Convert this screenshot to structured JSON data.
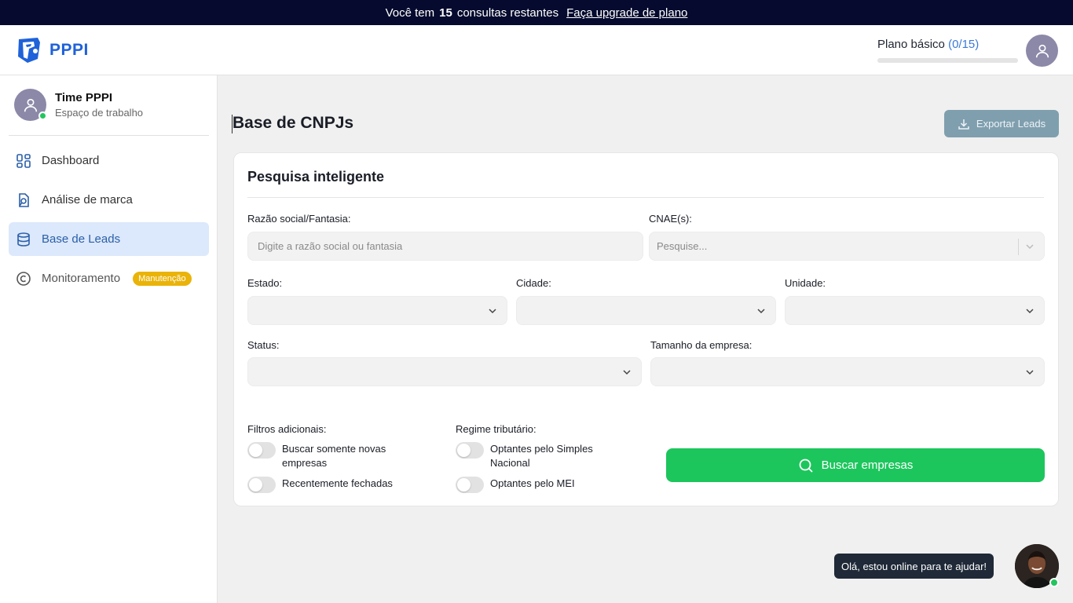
{
  "banner": {
    "prefix": "Você tem",
    "count": "15",
    "suffix": "consultas restantes",
    "link": "Faça upgrade de plano"
  },
  "header": {
    "brand": "PPPI",
    "plan_label": "Plano básico",
    "plan_count": "(0/15)",
    "plan_usage_fraction": 0
  },
  "sidebar": {
    "workspace_name": "Time PPPI",
    "workspace_sub": "Espaço de trabalho",
    "items": [
      {
        "label": "Dashboard",
        "icon": "dashboard-icon"
      },
      {
        "label": "Análise de marca",
        "icon": "brand-analysis-icon"
      },
      {
        "label": "Base de Leads",
        "icon": "database-icon",
        "active": true
      },
      {
        "label": "Monitoramento",
        "icon": "copyright-icon",
        "badge": "Manutenção"
      }
    ]
  },
  "main": {
    "title": "Base de CNPJs",
    "export_label": "Exportar Leads"
  },
  "search": {
    "title": "Pesquisa inteligente",
    "razao_label": "Razão social/Fantasia:",
    "razao_placeholder": "Digite a razão social ou fantasia",
    "cnae_label": "CNAE(s):",
    "cnae_placeholder": "Pesquise...",
    "estado_label": "Estado:",
    "cidade_label": "Cidade:",
    "unidade_label": "Unidade:",
    "status_label": "Status:",
    "tamanho_label": "Tamanho da empresa:",
    "filtros_label": "Filtros adicionais:",
    "regime_label": "Regime tributário:",
    "toggle_novas": "Buscar somente novas empresas",
    "toggle_fechadas": "Recentemente fechadas",
    "toggle_simples": "Optantes pelo Simples Nacional",
    "toggle_mei": "Optantes pelo MEI",
    "button_label": "Buscar empresas"
  },
  "chat": {
    "message": "Olá, estou online para te ajudar!"
  },
  "colors": {
    "accent": "#1f62d9",
    "banner_bg": "#050a2e",
    "primary_green": "#1cc65c",
    "badge_yellow": "#eab308",
    "export_btn": "#7f9fae"
  }
}
